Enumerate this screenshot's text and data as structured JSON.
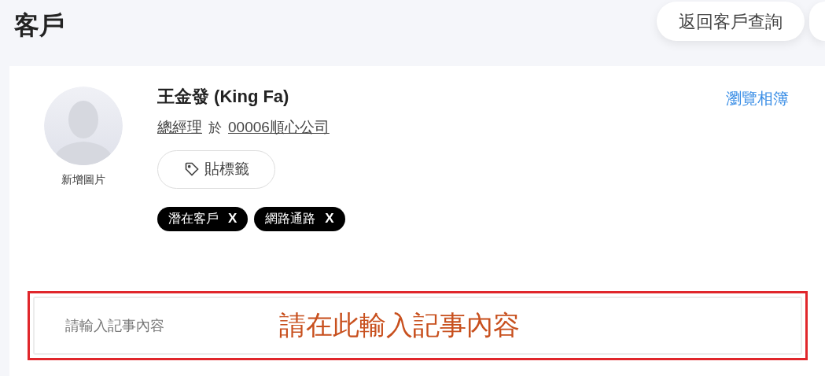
{
  "page_title": "客戶",
  "back_button": "返回客戶查詢",
  "profile": {
    "avatar_caption": "新增圖片",
    "name": "王金發 (King Fa)",
    "job_title": "總經理",
    "connector": "於",
    "company": "00006順心公司",
    "tag_button": "貼標籤",
    "tags": [
      {
        "label": "潛在客戶",
        "remove": "X"
      },
      {
        "label": "網路通路",
        "remove": "X"
      }
    ]
  },
  "album_link": "瀏覽相簿",
  "note": {
    "placeholder": "請輸入記事內容"
  },
  "annotation": "請在此輸入記事內容"
}
